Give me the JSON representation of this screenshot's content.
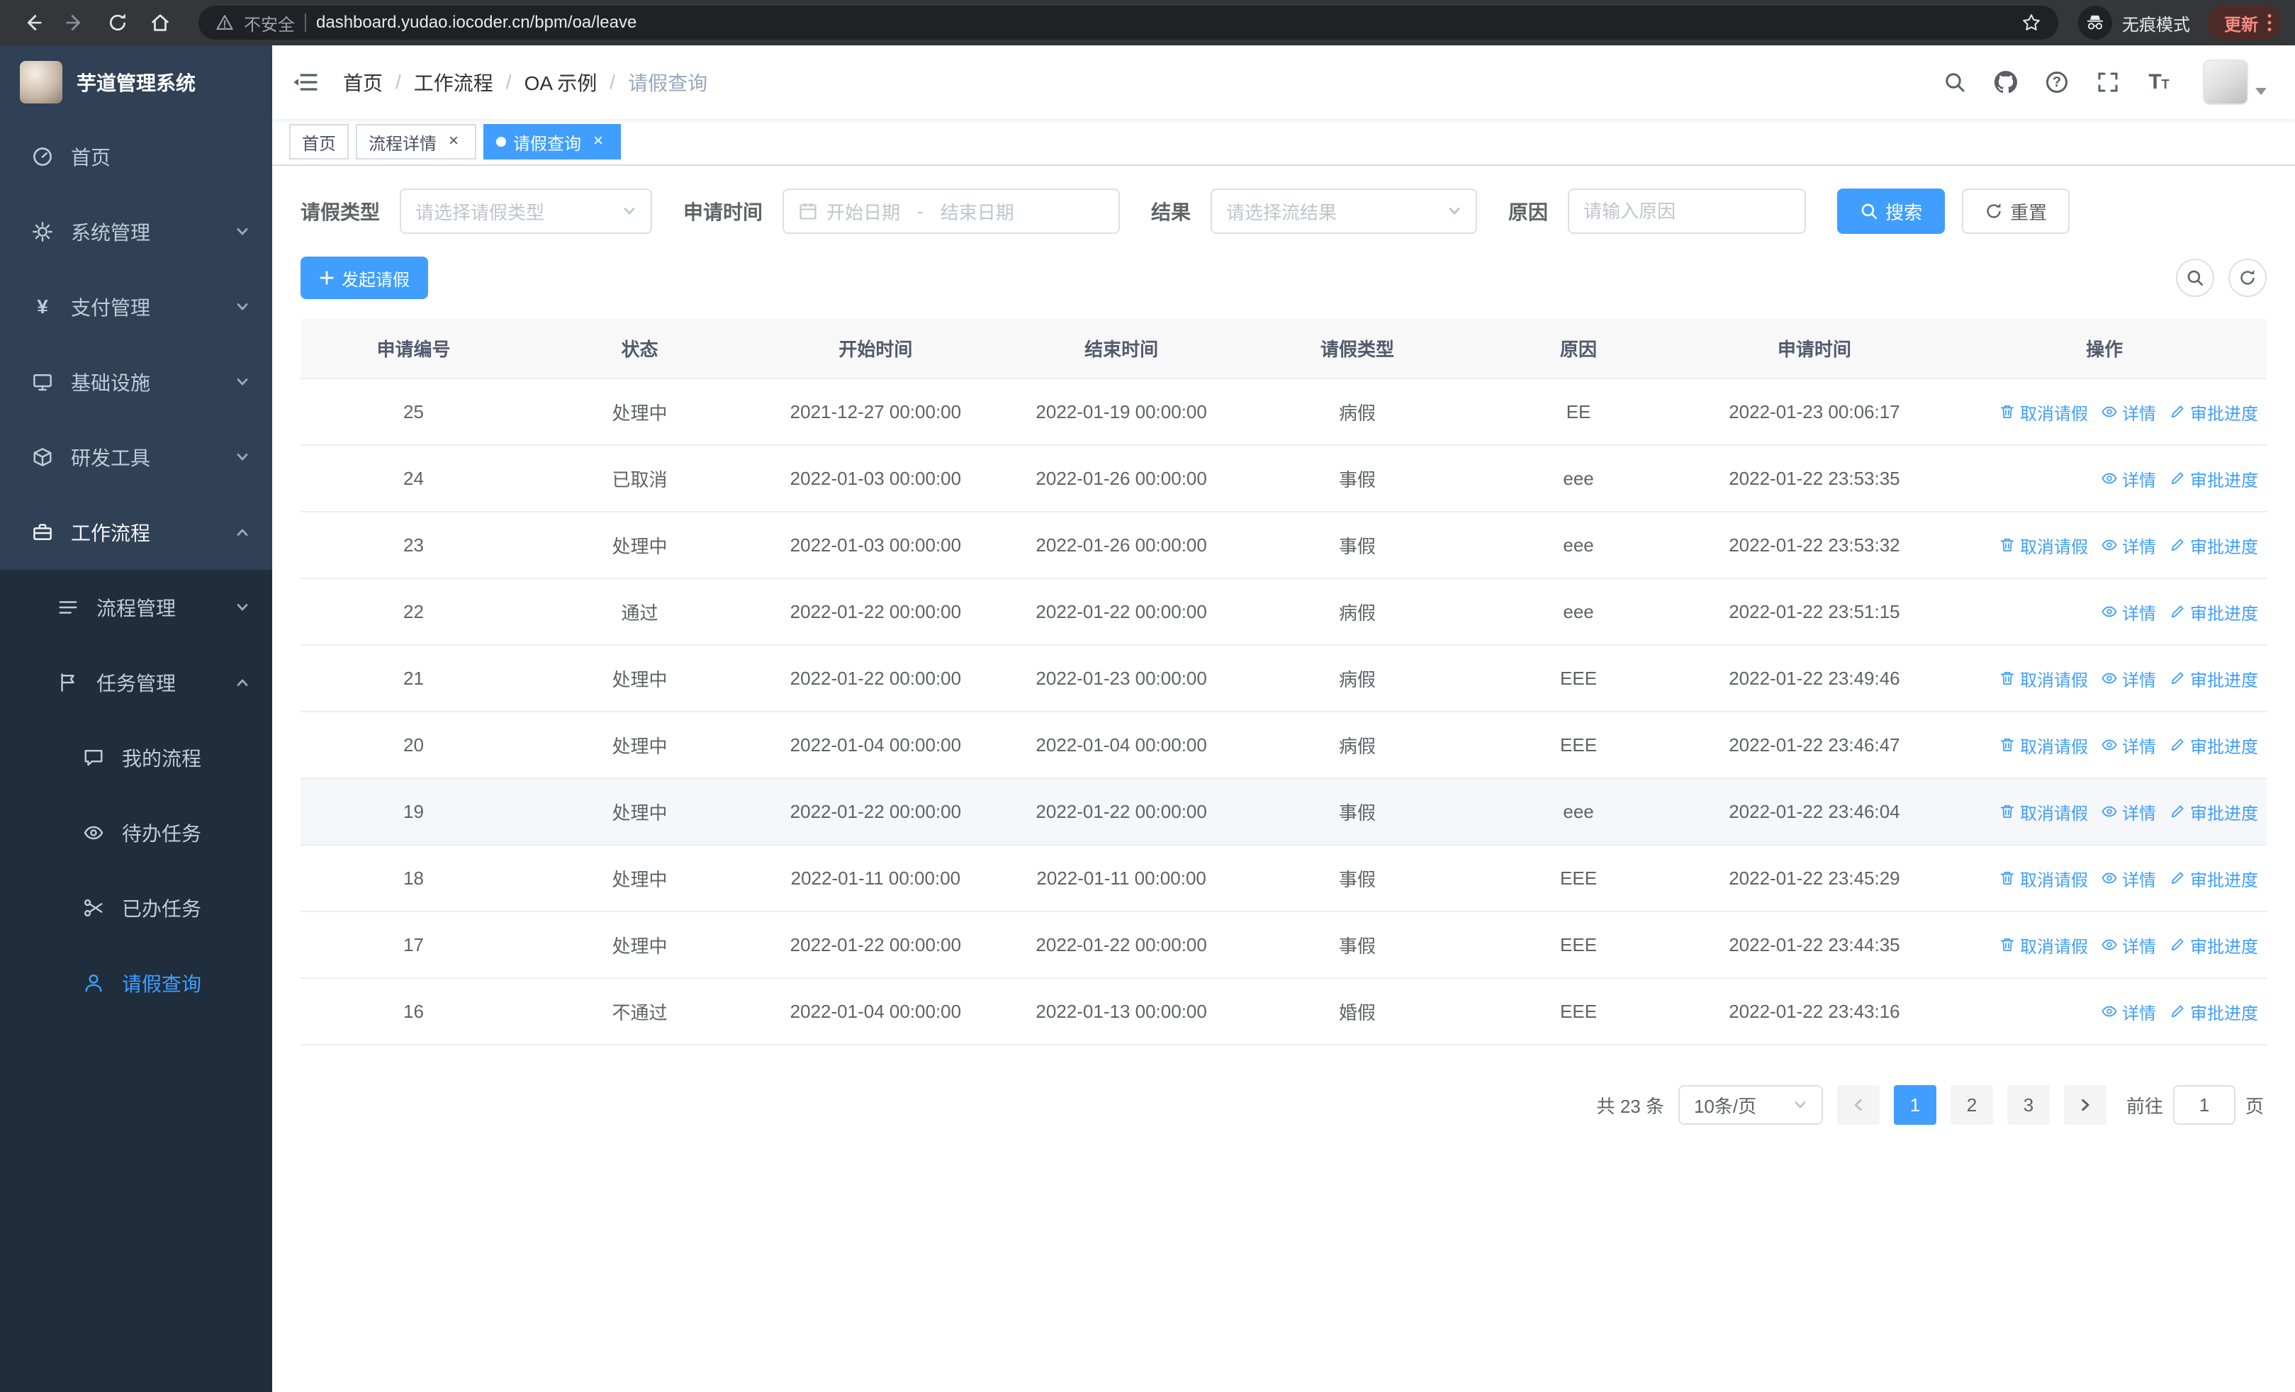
{
  "theme": {
    "primary": "#409eff",
    "sidebar_bg": "#304156",
    "sidebar_submenu_bg": "#1f2d3d",
    "link_color": "#409eff"
  },
  "browser": {
    "security_label": "不安全",
    "url": "dashboard.yudao.iocoder.cn/bpm/oa/leave",
    "incognito_label": "无痕模式",
    "update_label": "更新"
  },
  "sidebar": {
    "logo_title": "芋道管理系统",
    "top_items": [
      {
        "label": "首页",
        "icon": "dashboard-icon"
      },
      {
        "label": "系统管理",
        "icon": "gear-icon"
      },
      {
        "label": "支付管理",
        "icon": "yen-icon"
      },
      {
        "label": "基础设施",
        "icon": "monitor-icon"
      },
      {
        "label": "研发工具",
        "icon": "cube-icon"
      },
      {
        "label": "工作流程",
        "icon": "briefcase-icon"
      }
    ],
    "process_mgmt": {
      "label": "流程管理"
    },
    "task_mgmt": {
      "label": "任务管理"
    },
    "task_children": [
      {
        "label": "我的流程"
      },
      {
        "label": "待办任务"
      },
      {
        "label": "已办任务"
      },
      {
        "label": "请假查询",
        "active": true
      }
    ]
  },
  "header": {
    "breadcrumb": [
      "首页",
      "工作流程",
      "OA 示例",
      "请假查询"
    ]
  },
  "tabs": [
    {
      "label": "首页",
      "closable": false,
      "active": false
    },
    {
      "label": "流程详情",
      "closable": true,
      "active": false
    },
    {
      "label": "请假查询",
      "closable": true,
      "active": true
    }
  ],
  "filters": {
    "leave_type_label": "请假类型",
    "leave_type_placeholder": "请选择请假类型",
    "apply_time_label": "申请时间",
    "start_date_placeholder": "开始日期",
    "range_separator": "-",
    "end_date_placeholder": "结束日期",
    "result_label": "结果",
    "result_placeholder": "请选择流结果",
    "reason_label": "原因",
    "reason_placeholder": "请输入原因",
    "search_label": "搜索",
    "reset_label": "重置"
  },
  "toolbar": {
    "create_label": "发起请假"
  },
  "table": {
    "headers": [
      "申请编号",
      "状态",
      "开始时间",
      "结束时间",
      "请假类型",
      "原因",
      "申请时间",
      "操作"
    ],
    "rows": [
      {
        "id": "25",
        "status": "处理中",
        "start": "2021-12-27 00:00:00",
        "end": "2022-01-19 00:00:00",
        "type": "病假",
        "reason": "EE",
        "applied": "2022-01-23 00:06:17",
        "highlight": false,
        "actions": [
          {
            "label": "取消请假",
            "icon": "cancel"
          },
          {
            "label": "详情",
            "icon": "eye"
          },
          {
            "label": "审批进度",
            "icon": "edit"
          }
        ]
      },
      {
        "id": "24",
        "status": "已取消",
        "start": "2022-01-03 00:00:00",
        "end": "2022-01-26 00:00:00",
        "type": "事假",
        "reason": "eee",
        "applied": "2022-01-22 23:53:35",
        "highlight": false,
        "actions": [
          {
            "label": "详情",
            "icon": "eye"
          },
          {
            "label": "审批进度",
            "icon": "edit"
          }
        ]
      },
      {
        "id": "23",
        "status": "处理中",
        "start": "2022-01-03 00:00:00",
        "end": "2022-01-26 00:00:00",
        "type": "事假",
        "reason": "eee",
        "applied": "2022-01-22 23:53:32",
        "highlight": false,
        "actions": [
          {
            "label": "取消请假",
            "icon": "cancel"
          },
          {
            "label": "详情",
            "icon": "eye"
          },
          {
            "label": "审批进度",
            "icon": "edit"
          }
        ]
      },
      {
        "id": "22",
        "status": "通过",
        "start": "2022-01-22 00:00:00",
        "end": "2022-01-22 00:00:00",
        "type": "病假",
        "reason": "eee",
        "applied": "2022-01-22 23:51:15",
        "highlight": false,
        "actions": [
          {
            "label": "详情",
            "icon": "eye"
          },
          {
            "label": "审批进度",
            "icon": "edit"
          }
        ]
      },
      {
        "id": "21",
        "status": "处理中",
        "start": "2022-01-22 00:00:00",
        "end": "2022-01-23 00:00:00",
        "type": "病假",
        "reason": "EEE",
        "applied": "2022-01-22 23:49:46",
        "highlight": false,
        "actions": [
          {
            "label": "取消请假",
            "icon": "cancel"
          },
          {
            "label": "详情",
            "icon": "eye"
          },
          {
            "label": "审批进度",
            "icon": "edit"
          }
        ]
      },
      {
        "id": "20",
        "status": "处理中",
        "start": "2022-01-04 00:00:00",
        "end": "2022-01-04 00:00:00",
        "type": "病假",
        "reason": "EEE",
        "applied": "2022-01-22 23:46:47",
        "highlight": false,
        "actions": [
          {
            "label": "取消请假",
            "icon": "cancel"
          },
          {
            "label": "详情",
            "icon": "eye"
          },
          {
            "label": "审批进度",
            "icon": "edit"
          }
        ]
      },
      {
        "id": "19",
        "status": "处理中",
        "start": "2022-01-22 00:00:00",
        "end": "2022-01-22 00:00:00",
        "type": "事假",
        "reason": "eee",
        "applied": "2022-01-22 23:46:04",
        "highlight": true,
        "actions": [
          {
            "label": "取消请假",
            "icon": "cancel"
          },
          {
            "label": "详情",
            "icon": "eye"
          },
          {
            "label": "审批进度",
            "icon": "edit"
          }
        ]
      },
      {
        "id": "18",
        "status": "处理中",
        "start": "2022-01-11 00:00:00",
        "end": "2022-01-11 00:00:00",
        "type": "事假",
        "reason": "EEE",
        "applied": "2022-01-22 23:45:29",
        "highlight": false,
        "actions": [
          {
            "label": "取消请假",
            "icon": "cancel"
          },
          {
            "label": "详情",
            "icon": "eye"
          },
          {
            "label": "审批进度",
            "icon": "edit"
          }
        ]
      },
      {
        "id": "17",
        "status": "处理中",
        "start": "2022-01-22 00:00:00",
        "end": "2022-01-22 00:00:00",
        "type": "事假",
        "reason": "EEE",
        "applied": "2022-01-22 23:44:35",
        "highlight": false,
        "actions": [
          {
            "label": "取消请假",
            "icon": "cancel"
          },
          {
            "label": "详情",
            "icon": "eye"
          },
          {
            "label": "审批进度",
            "icon": "edit"
          }
        ]
      },
      {
        "id": "16",
        "status": "不通过",
        "start": "2022-01-04 00:00:00",
        "end": "2022-01-13 00:00:00",
        "type": "婚假",
        "reason": "EEE",
        "applied": "2022-01-22 23:43:16",
        "highlight": false,
        "actions": [
          {
            "label": "详情",
            "icon": "eye"
          },
          {
            "label": "审批进度",
            "icon": "edit"
          }
        ]
      }
    ]
  },
  "pagination": {
    "total": "共 23 条",
    "page_size": "10条/页",
    "pages": [
      "1",
      "2",
      "3"
    ],
    "active_page": "1",
    "goto_label": "前往",
    "goto_value": "1",
    "page_unit": "页"
  }
}
